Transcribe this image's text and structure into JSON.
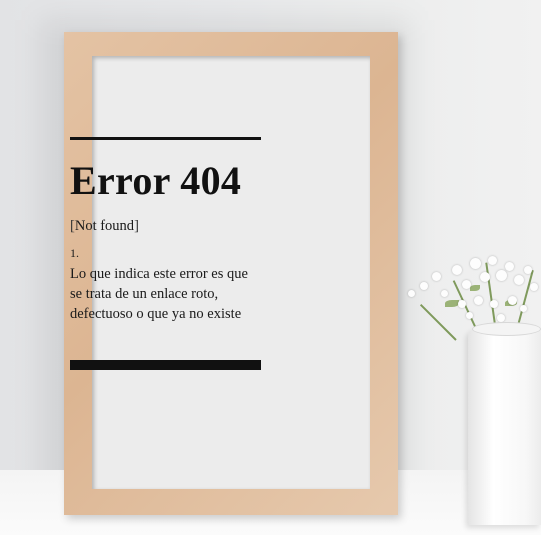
{
  "poster": {
    "word": "Error 404",
    "bracket_open": "[",
    "tag": "Not found",
    "bracket_close": "]",
    "sense_number": "1.",
    "definition_lines": [
      "Lo que indica este error es que",
      "se trata de un enlace roto,",
      "defectuoso o que ya no existe"
    ]
  },
  "colors": {
    "frame_wood": "#dcb592",
    "paper": "#ececec",
    "ink": "#111111",
    "wall": "#e7e8ea"
  }
}
